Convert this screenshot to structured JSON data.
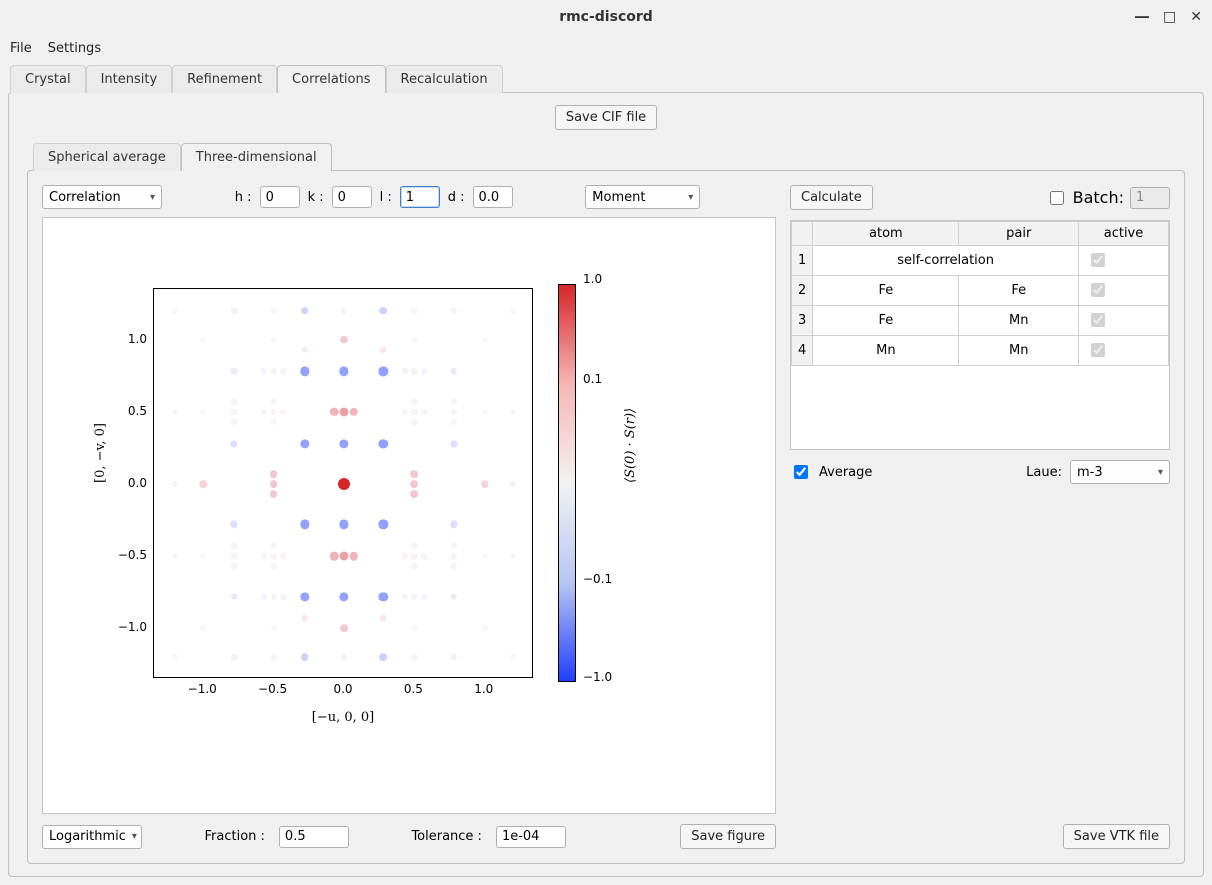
{
  "window": {
    "title": "rmc-discord"
  },
  "menubar": [
    "File",
    "Settings"
  ],
  "main_tabs": [
    "Crystal",
    "Intensity",
    "Refinement",
    "Correlations",
    "Recalculation"
  ],
  "active_main_tab": 3,
  "save_cif": "Save CIF file",
  "sub_tabs": [
    "Spherical average",
    "Three-dimensional"
  ],
  "active_sub_tab": 1,
  "left": {
    "corr_combo": "Correlation",
    "h_label": "h :",
    "h_val": "0",
    "k_label": "k :",
    "k_val": "0",
    "l_label": "l :",
    "l_val": "1",
    "d_label": "d :",
    "d_val": "0.0",
    "moment_combo": "Moment",
    "scale_combo": "Logarithmic",
    "fraction_label": "Fraction :",
    "fraction_val": "0.5",
    "tolerance_label": "Tolerance :",
    "tolerance_val": "1e-04",
    "save_fig": "Save figure"
  },
  "right": {
    "calculate": "Calculate",
    "batch_label": "Batch:",
    "batch_val": "1",
    "headers": [
      "atom",
      "pair",
      "active"
    ],
    "rows": [
      {
        "n": "1",
        "atom": "self-correlation",
        "pair": "",
        "span": true
      },
      {
        "n": "2",
        "atom": "Fe",
        "pair": "Fe"
      },
      {
        "n": "3",
        "atom": "Fe",
        "pair": "Mn"
      },
      {
        "n": "4",
        "atom": "Mn",
        "pair": "Mn"
      }
    ],
    "average_label": "Average",
    "laue_label": "Laue:",
    "laue_val": "m-3",
    "save_vtk": "Save VTK file"
  },
  "chart_data": {
    "type": "scatter",
    "xlabel": "[−u, 0, 0]",
    "ylabel": "[0, −v, 0]",
    "colorbar_label": "⟨S(0) · S(r)⟩",
    "xlim": [
      -1.35,
      1.35
    ],
    "ylim": [
      -1.35,
      1.35
    ],
    "clim": [
      -1.0,
      1.0
    ],
    "cscale": "symlog",
    "xticks": [
      -1.0,
      -0.5,
      0.0,
      0.5,
      1.0
    ],
    "yticks": [
      -1.0,
      -0.5,
      0.0,
      0.5,
      1.0
    ],
    "cticks": [
      1.0,
      0.1,
      -0.1,
      -1.0
    ],
    "points": [
      [
        -1.2,
        1.2,
        -0.02
      ],
      [
        -1.2,
        0.5,
        -0.04
      ],
      [
        -1.2,
        0.0,
        -0.06
      ],
      [
        -1.2,
        -0.5,
        -0.04
      ],
      [
        -1.2,
        -1.2,
        -0.02
      ],
      [
        1.2,
        1.2,
        -0.02
      ],
      [
        1.2,
        0.5,
        -0.04
      ],
      [
        1.2,
        0.0,
        -0.06
      ],
      [
        1.2,
        -0.5,
        -0.04
      ],
      [
        1.2,
        -1.2,
        -0.02
      ],
      [
        -1.0,
        1.0,
        0.03
      ],
      [
        -1.0,
        0.5,
        0.03
      ],
      [
        -1.0,
        0.0,
        0.25
      ],
      [
        -1.0,
        -0.5,
        0.03
      ],
      [
        -1.0,
        -1.0,
        0.03
      ],
      [
        1.0,
        1.0,
        0.03
      ],
      [
        1.0,
        0.5,
        0.03
      ],
      [
        1.0,
        0.0,
        0.25
      ],
      [
        1.0,
        -0.5,
        0.03
      ],
      [
        1.0,
        -1.0,
        0.03
      ],
      [
        -0.78,
        1.2,
        -0.07
      ],
      [
        -0.78,
        0.78,
        -0.12
      ],
      [
        -0.78,
        0.57,
        -0.05
      ],
      [
        -0.78,
        0.5,
        0.06
      ],
      [
        -0.78,
        0.43,
        -0.05
      ],
      [
        -0.78,
        0.28,
        -0.2
      ],
      [
        -0.78,
        -0.28,
        -0.2
      ],
      [
        -0.78,
        -0.43,
        -0.05
      ],
      [
        -0.78,
        -0.5,
        0.06
      ],
      [
        -0.78,
        -0.57,
        -0.05
      ],
      [
        -0.78,
        -0.78,
        -0.12
      ],
      [
        -0.78,
        -1.2,
        -0.07
      ],
      [
        0.78,
        1.2,
        -0.07
      ],
      [
        0.78,
        0.78,
        -0.12
      ],
      [
        0.78,
        0.57,
        -0.05
      ],
      [
        0.78,
        0.5,
        0.06
      ],
      [
        0.78,
        0.43,
        -0.05
      ],
      [
        0.78,
        0.28,
        -0.2
      ],
      [
        0.78,
        -0.28,
        -0.2
      ],
      [
        0.78,
        -0.43,
        -0.05
      ],
      [
        0.78,
        -0.5,
        0.06
      ],
      [
        0.78,
        -0.57,
        -0.05
      ],
      [
        0.78,
        -0.78,
        -0.12
      ],
      [
        0.78,
        -1.2,
        -0.07
      ],
      [
        -0.57,
        0.78,
        -0.05
      ],
      [
        -0.57,
        0.5,
        0.05
      ],
      [
        -0.57,
        -0.5,
        0.05
      ],
      [
        -0.57,
        -0.78,
        -0.05
      ],
      [
        0.57,
        0.78,
        -0.05
      ],
      [
        0.57,
        0.5,
        0.05
      ],
      [
        0.57,
        -0.5,
        0.05
      ],
      [
        0.57,
        -0.78,
        -0.05
      ],
      [
        -0.5,
        1.2,
        -0.04
      ],
      [
        -0.5,
        1.0,
        0.03
      ],
      [
        -0.5,
        0.78,
        0.06
      ],
      [
        -0.5,
        0.57,
        0.05
      ],
      [
        -0.5,
        0.5,
        0.06
      ],
      [
        -0.5,
        0.43,
        0.05
      ],
      [
        -0.5,
        0.07,
        0.3
      ],
      [
        -0.5,
        0.0,
        0.3
      ],
      [
        -0.5,
        -0.07,
        0.3
      ],
      [
        -0.5,
        -0.43,
        0.05
      ],
      [
        -0.5,
        -0.5,
        0.06
      ],
      [
        -0.5,
        -0.57,
        0.05
      ],
      [
        -0.5,
        -0.78,
        0.06
      ],
      [
        -0.5,
        -1.0,
        0.03
      ],
      [
        -0.5,
        -1.2,
        -0.04
      ],
      [
        0.5,
        1.2,
        -0.04
      ],
      [
        0.5,
        1.0,
        0.03
      ],
      [
        0.5,
        0.78,
        0.06
      ],
      [
        0.5,
        0.57,
        0.05
      ],
      [
        0.5,
        0.5,
        0.06
      ],
      [
        0.5,
        0.43,
        0.05
      ],
      [
        0.5,
        0.07,
        0.3
      ],
      [
        0.5,
        0.0,
        0.3
      ],
      [
        0.5,
        -0.07,
        0.3
      ],
      [
        0.5,
        -0.43,
        0.05
      ],
      [
        0.5,
        -0.5,
        0.06
      ],
      [
        0.5,
        -0.57,
        0.05
      ],
      [
        0.5,
        -0.78,
        0.06
      ],
      [
        0.5,
        -1.0,
        0.03
      ],
      [
        0.5,
        -1.2,
        -0.04
      ],
      [
        -0.43,
        0.78,
        -0.05
      ],
      [
        -0.43,
        0.5,
        0.05
      ],
      [
        -0.43,
        -0.5,
        0.05
      ],
      [
        -0.43,
        -0.78,
        -0.05
      ],
      [
        0.43,
        0.78,
        -0.05
      ],
      [
        0.43,
        0.5,
        0.05
      ],
      [
        0.43,
        -0.5,
        0.05
      ],
      [
        0.43,
        -0.78,
        -0.05
      ],
      [
        -0.28,
        1.2,
        -0.28
      ],
      [
        -0.28,
        0.93,
        0.12
      ],
      [
        -0.28,
        0.78,
        -0.55
      ],
      [
        -0.28,
        0.28,
        -0.55
      ],
      [
        -0.28,
        -0.28,
        -0.55
      ],
      [
        -0.28,
        -0.78,
        -0.55
      ],
      [
        -0.28,
        -0.93,
        0.12
      ],
      [
        -0.28,
        -1.2,
        -0.28
      ],
      [
        0.28,
        1.2,
        -0.28
      ],
      [
        0.28,
        0.93,
        0.12
      ],
      [
        0.28,
        0.78,
        -0.55
      ],
      [
        0.28,
        0.28,
        -0.55
      ],
      [
        0.28,
        -0.28,
        -0.55
      ],
      [
        0.28,
        -0.78,
        -0.55
      ],
      [
        0.28,
        -0.93,
        0.12
      ],
      [
        0.28,
        -1.2,
        -0.28
      ],
      [
        -0.07,
        0.5,
        0.4
      ],
      [
        -0.07,
        -0.5,
        0.4
      ],
      [
        0.07,
        0.5,
        0.4
      ],
      [
        0.07,
        -0.5,
        0.4
      ],
      [
        0.0,
        1.2,
        -0.06
      ],
      [
        0.0,
        1.0,
        0.3
      ],
      [
        0.0,
        0.78,
        -0.55
      ],
      [
        0.0,
        0.5,
        0.5
      ],
      [
        0.0,
        0.28,
        -0.55
      ],
      [
        0.0,
        0.0,
        1.0
      ],
      [
        0.0,
        -0.28,
        -0.55
      ],
      [
        0.0,
        -0.5,
        0.5
      ],
      [
        0.0,
        -0.78,
        -0.55
      ],
      [
        0.0,
        -1.0,
        0.3
      ],
      [
        0.0,
        -1.2,
        -0.06
      ]
    ]
  }
}
